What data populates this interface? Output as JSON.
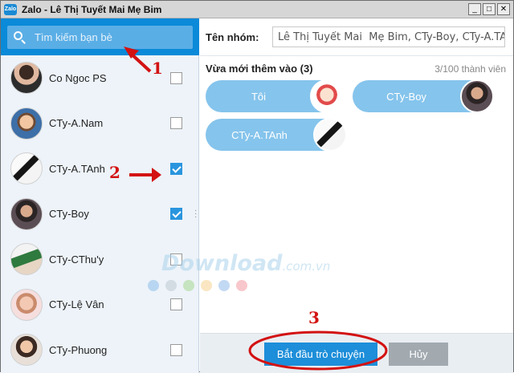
{
  "window": {
    "title": "Zalo - Lê Thị Tuyết Mai  Mẹ Bim",
    "app_icon_text": "Zalo",
    "minimize": "_",
    "maximize": "□",
    "close": "✕"
  },
  "search": {
    "placeholder": "Tìm kiếm bạn bè",
    "value": ""
  },
  "contacts": [
    {
      "name": "Co Ngoc PS",
      "checked": false
    },
    {
      "name": "CTy-A.Nam",
      "checked": false
    },
    {
      "name": "CTy-A.TAnh",
      "checked": true
    },
    {
      "name": "CTy-Boy",
      "checked": true
    },
    {
      "name": "CTy-CThu'y",
      "checked": false
    },
    {
      "name": "CTy-Lệ Vân",
      "checked": false
    },
    {
      "name": "CTy-Phuong",
      "checked": false
    }
  ],
  "group": {
    "label": "Tên nhóm:",
    "value": "Lê Thị Tuyết Mai  Mẹ Bim, CTy-Boy, CTy-A.TAnh"
  },
  "recent": {
    "label": "Vừa mới thêm vào (3)",
    "count": "3/100 thành viên",
    "members": [
      "Tôi",
      "CTy-Boy",
      "CTy-A.TAnh"
    ]
  },
  "footer": {
    "start_label": "Bắt đầu trò chuyện",
    "cancel_label": "Hủy"
  },
  "annotations": [
    "1",
    "2",
    "3"
  ],
  "watermark": {
    "main": "Download",
    "sub": ".com.vn"
  },
  "colors": {
    "accent": "#0a8ad8",
    "pill": "#85c4ec",
    "annotation": "#d31212",
    "cancel": "#a2aab0"
  }
}
